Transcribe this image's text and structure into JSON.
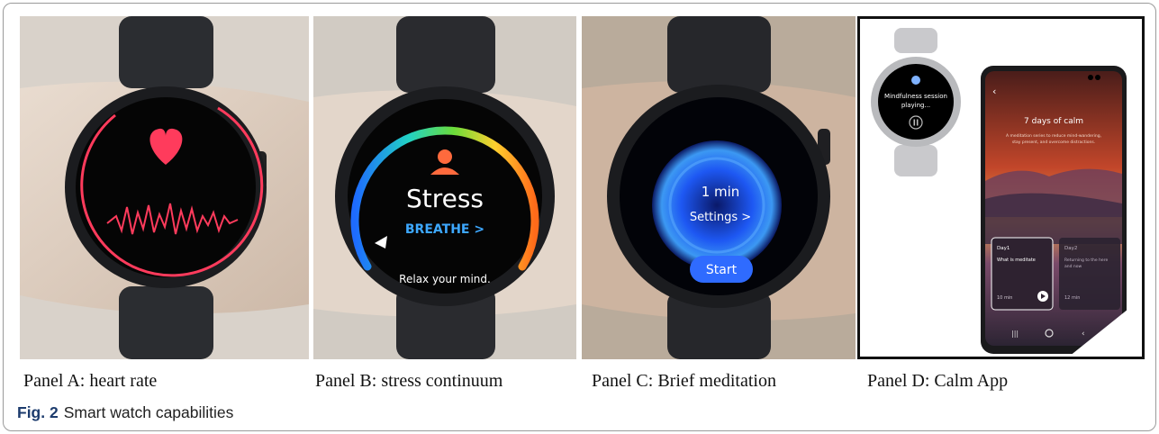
{
  "figure": {
    "label": "Fig. 2",
    "title": "Smart watch capabilities"
  },
  "panels": [
    {
      "caption": "Panel A: heart rate"
    },
    {
      "caption": "Panel B: stress continuum",
      "screen": {
        "title": "Stress",
        "action": "BREATHE >",
        "message": "Relax your mind."
      }
    },
    {
      "caption": "Panel C: Brief meditation",
      "screen": {
        "duration": "1 min",
        "settings": "Settings >",
        "start": "Start"
      }
    },
    {
      "caption": "Panel D: Calm App",
      "watch_screen": {
        "line1": "Mindfulness session",
        "line2": "playing..."
      },
      "phone": {
        "title": "7 days of calm",
        "subtitle_line1": "A meditation series to reduce mind-wandering,",
        "subtitle_line2": "stay present, and overcome distractions.",
        "cards": [
          {
            "day": "Day1",
            "name": "What is meditate",
            "duration": "10 min"
          },
          {
            "day": "Day2",
            "name": "Returning to the here",
            "name_line2": "and now",
            "duration": "12 min"
          }
        ]
      }
    }
  ],
  "colors": {
    "heart": "#ff3b5c",
    "stress_gradient": [
      "#1e6bff",
      "#22d3c5",
      "#6bdc3a",
      "#ffcf2e",
      "#ff6a1a"
    ],
    "meditation_glow": "#1f5cff",
    "caption_label": "#1d3c6e"
  }
}
